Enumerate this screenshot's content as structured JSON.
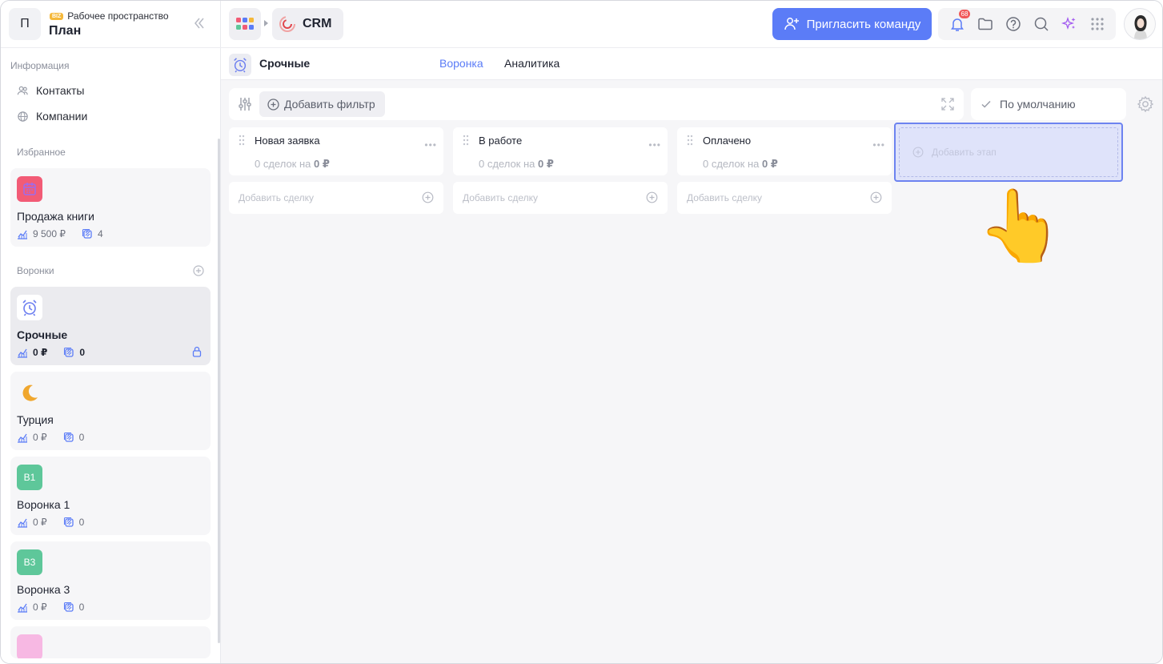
{
  "workspace": {
    "avatar_letter": "П",
    "badge": "BIZ",
    "subtitle": "Рабочее пространство",
    "title": "План"
  },
  "sidebar": {
    "info_label": "Информация",
    "contacts": "Контакты",
    "companies": "Компании",
    "favorites_label": "Избранное",
    "funnels_label": "Воронки",
    "favorites": [
      {
        "name": "Продажа книги",
        "amount": "9 500 ₽",
        "count": "4",
        "icon": "calendar-icon",
        "color": "#f25b76"
      }
    ],
    "funnels": [
      {
        "name": "Срочные",
        "amount": "0 ₽",
        "count": "0",
        "icon": "alarm-clock-icon",
        "active": true
      },
      {
        "name": "Турция",
        "amount": "0 ₽",
        "count": "0",
        "icon": "crescent-moon-icon"
      },
      {
        "name": "Воронка 1",
        "amount": "0 ₽",
        "count": "0",
        "icon_text": "В1",
        "color": "#5ec79a"
      },
      {
        "name": "Воронка 3",
        "amount": "0 ₽",
        "count": "0",
        "icon_text": "В3",
        "color": "#5ec79a"
      }
    ]
  },
  "topbar": {
    "app_name": "CRM",
    "invite_label": "Пригласить команду",
    "notifications_count": "68"
  },
  "subheader": {
    "funnel_title": "Срочные",
    "tabs": [
      "Воронка",
      "Аналитика"
    ]
  },
  "filters": {
    "add_filter_label": "Добавить фильтр",
    "default_view_label": "По умолчанию"
  },
  "stages": [
    {
      "name": "Новая заявка",
      "deals_prefix": "0 сделок на",
      "amount": "0 ₽"
    },
    {
      "name": "В работе",
      "deals_prefix": "0 сделок на",
      "amount": "0 ₽"
    },
    {
      "name": "Оплачено",
      "deals_prefix": "0 сделок на",
      "amount": "0 ₽"
    }
  ],
  "add_deal_label": "Добавить сделку",
  "add_stage_label": "Добавить этап",
  "colors": {
    "accent": "#5b7cf7",
    "brand_red": "#f25b76",
    "green": "#5ec79a"
  }
}
